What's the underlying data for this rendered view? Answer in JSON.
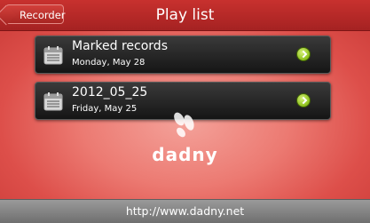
{
  "header": {
    "back_label": "Recorder",
    "title": "Play list"
  },
  "list": {
    "items": [
      {
        "title": "Marked records",
        "subtitle": "Monday, May 28",
        "icon": "calendar-icon",
        "action_icon": "chevron-right-icon"
      },
      {
        "title": "2012_05_25",
        "subtitle": "Friday, May 25",
        "icon": "calendar-icon",
        "action_icon": "chevron-right-icon"
      }
    ]
  },
  "branding": {
    "name": "dadny"
  },
  "footer": {
    "url": "http://www.dadny.net"
  },
  "colors": {
    "header_red": "#b52a27",
    "background_red": "#e35f5a",
    "list_dark": "#1e1e1e",
    "go_green": "#8bbf1a",
    "footer_gray": "#858585"
  }
}
